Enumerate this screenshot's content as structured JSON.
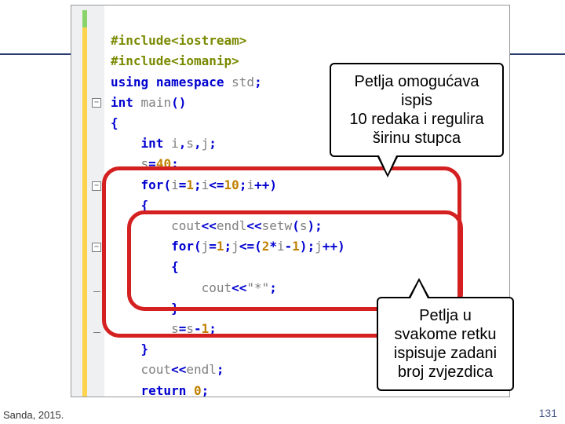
{
  "code": {
    "l1_pre": "#include",
    "l1_inc": "<iostream>",
    "l2_pre": "#include",
    "l2_inc": "<iomanip>",
    "l3_kw1": "using",
    "l3_kw2": "namespace",
    "l3_id": "std",
    "l3_semi": ";",
    "l4_kw": "int",
    "l4_id": "main",
    "l4_par": "()",
    "l5_brace": "{",
    "l6_kw": "int",
    "l6_ids": "i",
    "l6_c1": ",",
    "l6_s": "s",
    "l6_c2": ",",
    "l6_j": "j",
    "l6_semi": ";",
    "l7_lhs": "s",
    "l7_eq": "=",
    "l7_rhs": "40",
    "l7_semi": ";",
    "l8_kw": "for",
    "l8_o": "(",
    "l8_i1": "i",
    "l8_eq": "=",
    "l8_n1": "1",
    "l8_s": ";",
    "l8_i2": "i",
    "l8_le": "<=",
    "l8_n2": "10",
    "l8_s2": ";",
    "l8_i3": "i",
    "l8_pp": "++",
    "l8_c": ")",
    "l9_brace": "{",
    "l10_cout": "cout",
    "l10_op1": "<<",
    "l10_endl": "endl",
    "l10_op2": "<<",
    "l10_setw": "setw",
    "l10_po": "(",
    "l10_s": "s",
    "l10_pc": ")",
    "l10_semi": ";",
    "l11_kw": "for",
    "l11_o": "(",
    "l11_j1": "j",
    "l11_eq": "=",
    "l11_n1": "1",
    "l11_s": ";",
    "l11_j2": "j",
    "l11_le": "<=",
    "l11_po": "(",
    "l11_n2": "2",
    "l11_st": "*",
    "l11_i": "i",
    "l11_mn": "-",
    "l11_n3": "1",
    "l11_pc": ")",
    "l11_s2": ";",
    "l11_j3": "j",
    "l11_pp": "++",
    "l11_c": ")",
    "l12_brace": "{",
    "l13_cout": "cout",
    "l13_op": "<<",
    "l13_str": "\"*\"",
    "l13_semi": ";",
    "l14_brace": "}",
    "l15_lhs": "s",
    "l15_eq": "=",
    "l15_rhs1": "s",
    "l15_mn": "-",
    "l15_rhs2": "1",
    "l15_semi": ";",
    "l16_brace": "}",
    "l17_cout": "cout",
    "l17_op": "<<",
    "l17_endl": "endl",
    "l17_semi": ";",
    "l18_kw": "return",
    "l18_n": "0",
    "l18_semi": ";"
  },
  "callouts": {
    "c1_line1": "Petlja omogućava ispis",
    "c1_line2": "10 redaka i regulira",
    "c1_line3": "širinu stupca",
    "c2_line1": "Petlja u",
    "c2_line2": "svakome retku",
    "c2_line3": "ispisuje zadani",
    "c2_line4": "broj zvjezdica"
  },
  "footer": {
    "left": "Sanda, 2015.",
    "right": "131"
  },
  "fold_glyph": "−"
}
